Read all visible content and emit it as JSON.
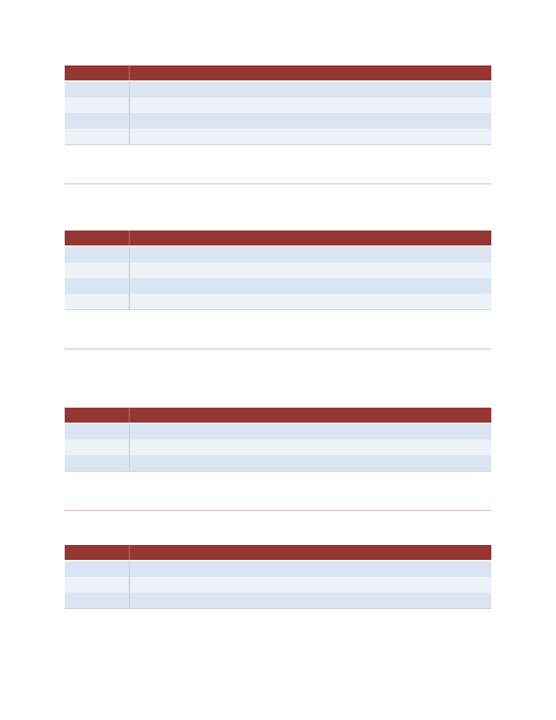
{
  "colors": {
    "header_fill": "#943634",
    "band_dark": "#dbe5f1",
    "band_light": "#edf2f9",
    "divider_line": "#d8a7a6",
    "column_rule": "#d4d4d4"
  },
  "tables": [
    {
      "header": [
        "",
        ""
      ],
      "rows": [
        [
          "",
          ""
        ],
        [
          "",
          ""
        ],
        [
          "",
          ""
        ],
        [
          "",
          ""
        ]
      ]
    },
    {
      "header": [
        "",
        ""
      ],
      "rows": [
        [
          "",
          ""
        ],
        [
          "",
          ""
        ],
        [
          "",
          ""
        ],
        [
          "",
          ""
        ]
      ]
    },
    {
      "header": [
        "",
        ""
      ],
      "rows": [
        [
          "",
          ""
        ],
        [
          "",
          ""
        ],
        [
          "",
          ""
        ]
      ]
    },
    {
      "header": [
        "",
        ""
      ],
      "rows": [
        [
          "",
          ""
        ],
        [
          "",
          ""
        ],
        [
          "",
          ""
        ]
      ]
    }
  ]
}
